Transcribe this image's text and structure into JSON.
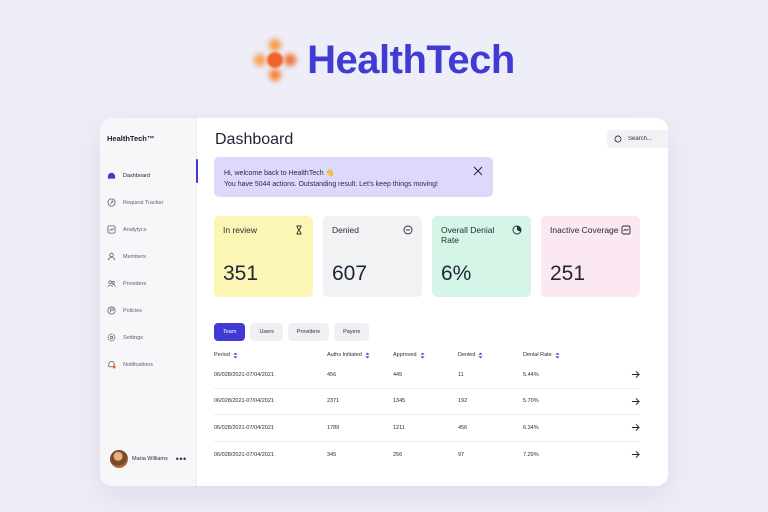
{
  "brand": {
    "name": "HealthTech"
  },
  "sidebar": {
    "title": "HealthTech™",
    "items": [
      {
        "label": "Dashboard",
        "icon": "dashboard-icon",
        "active": true
      },
      {
        "label": "Request Tracker",
        "icon": "tracker-icon"
      },
      {
        "label": "Analytycs",
        "icon": "analytics-icon"
      },
      {
        "label": "Members",
        "icon": "members-icon"
      },
      {
        "label": "Providers",
        "icon": "providers-icon"
      },
      {
        "label": "Policies",
        "icon": "policies-icon"
      },
      {
        "label": "Settings",
        "icon": "settings-icon"
      },
      {
        "label": "Notifications",
        "icon": "notifications-icon"
      }
    ],
    "user": {
      "name": "Maria Williams",
      "more": "•••"
    }
  },
  "header": {
    "title": "Dashboard",
    "search_placeholder": "Search..."
  },
  "banner": {
    "line1": "Hi, welcome back to HealthTech 👋",
    "line2": "You have 5044 actions. Outstanding result. Let's keep things moving!"
  },
  "cards": [
    {
      "label": "In review",
      "value": "351",
      "icon": "hourglass-icon",
      "color": "#fbf6b3"
    },
    {
      "label": "Denied",
      "value": "607",
      "icon": "minus-circle-icon",
      "color": "#f1f2f4"
    },
    {
      "label": "Overall Denial Rate",
      "value": "6%",
      "icon": "pie-chart-icon",
      "color": "#d5f6e6"
    },
    {
      "label": "Inactive Coverage",
      "value": "251",
      "icon": "line-chart-icon",
      "color": "#fbe8f2"
    }
  ],
  "tabs": [
    {
      "label": "Team",
      "active": true
    },
    {
      "label": "Users"
    },
    {
      "label": "Providers"
    },
    {
      "label": "Payers"
    }
  ],
  "table": {
    "columns": [
      "Period",
      "Auths Initiated",
      "Approved",
      "Denied",
      "Denial Rate"
    ],
    "rows": [
      [
        "06/028/2021-07/04/2021",
        "456",
        "445",
        "11",
        "5.44%"
      ],
      [
        "06/028/2021-07/04/2021",
        "2371",
        "1345",
        "192",
        "5.70%"
      ],
      [
        "06/028/2021-07/04/2021",
        "1789",
        "1211",
        "456",
        "6.34%"
      ],
      [
        "06/028/2021-07/04/2021",
        "345",
        "256",
        "97",
        "7.29%"
      ]
    ]
  },
  "colors": {
    "accent": "#3f3bd3",
    "brand_orange": "#f0622a"
  }
}
